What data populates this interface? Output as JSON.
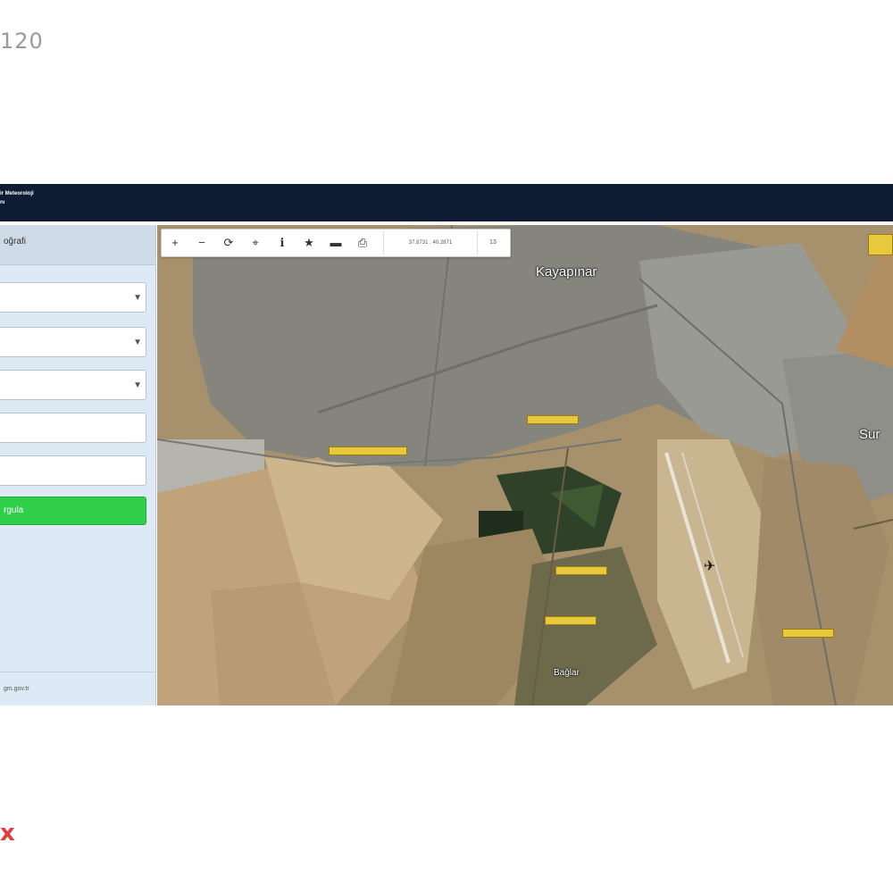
{
  "page_counter": "120",
  "corner_mark": "x",
  "header": {
    "title_line1": "ir Meteoroloji",
    "title_line2": "nı"
  },
  "sidebar": {
    "heading": "oğrafi",
    "dropdowns": [
      "",
      "",
      ""
    ],
    "inputs": [
      "",
      ""
    ],
    "query_button": "rgula",
    "footer": "gm.gov.tr"
  },
  "toolbar": {
    "icons": [
      "plus-icon",
      "minus-icon",
      "refresh-icon",
      "locate-icon",
      "info-icon",
      "star-icon",
      "line-icon",
      "print-icon"
    ],
    "glyphs": [
      "+",
      "−",
      "⟳",
      "⌖",
      "ℹ",
      "★",
      "▬",
      "⎙"
    ],
    "coordinates": "37.8731 : 40.2871",
    "zoom": "13"
  },
  "map": {
    "labels": {
      "kayapinar": "Kayapınar",
      "sur": "Sur",
      "baglar": "Bağlar"
    },
    "colors": {
      "terrain": "#a7916c",
      "urban": "#8c8c86",
      "road_label": "#e9c93c",
      "header": "#0e1b33",
      "button": "#2fcf4a"
    }
  }
}
